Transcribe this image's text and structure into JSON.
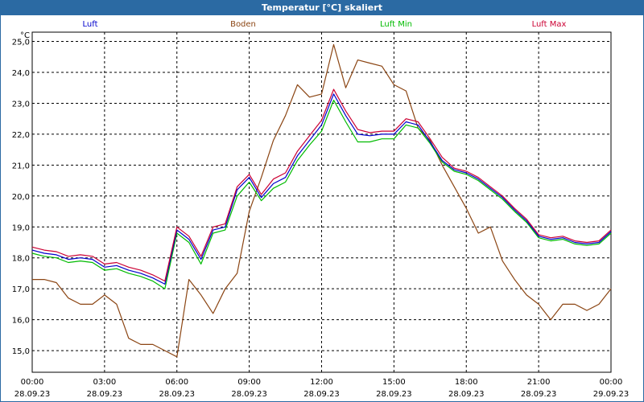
{
  "window": {
    "title": "Temperatur [°C] skaliert"
  },
  "chart_data": {
    "type": "line",
    "title": "Temperatur [°C] skaliert",
    "ylabel": "°C",
    "xlabel": "",
    "ylim": [
      14.3,
      25.3
    ],
    "xlim": [
      0,
      24
    ],
    "grid": true,
    "legend_position": "top",
    "y_ticks": [
      "15,0",
      "16,0",
      "17,0",
      "18,0",
      "19,0",
      "20,0",
      "21,0",
      "22,0",
      "23,0",
      "24,0",
      "25,0"
    ],
    "x_ticks": [
      {
        "time": "00:00",
        "date": "28.09.23"
      },
      {
        "time": "03:00",
        "date": "28.09.23"
      },
      {
        "time": "06:00",
        "date": "28.09.23"
      },
      {
        "time": "09:00",
        "date": "28.09.23"
      },
      {
        "time": "12:00",
        "date": "28.09.23"
      },
      {
        "time": "15:00",
        "date": "28.09.23"
      },
      {
        "time": "18:00",
        "date": "28.09.23"
      },
      {
        "time": "21:00",
        "date": "28.09.23"
      },
      {
        "time": "00:00",
        "date": "29.09.23"
      }
    ],
    "x": [
      0,
      0.5,
      1,
      1.5,
      2,
      2.5,
      3,
      3.5,
      4,
      4.5,
      5,
      5.5,
      6,
      6.5,
      7,
      7.5,
      8,
      8.5,
      9,
      9.5,
      10,
      10.5,
      11,
      11.5,
      12,
      12.5,
      13,
      13.5,
      14,
      14.5,
      15,
      15.5,
      16,
      16.5,
      17,
      17.5,
      18,
      18.5,
      19,
      19.5,
      20,
      20.5,
      21,
      21.5,
      22,
      22.5,
      23,
      23.5,
      24
    ],
    "series": [
      {
        "name": "Luft",
        "color": "#0000cc",
        "values": [
          18.25,
          18.15,
          18.1,
          17.95,
          18.0,
          17.95,
          17.7,
          17.75,
          17.6,
          17.5,
          17.35,
          17.15,
          18.9,
          18.6,
          17.95,
          18.9,
          19.0,
          20.2,
          20.6,
          19.95,
          20.4,
          20.6,
          21.3,
          21.8,
          22.3,
          23.3,
          22.6,
          22.0,
          21.95,
          22.0,
          22.0,
          22.4,
          22.3,
          21.75,
          21.15,
          20.85,
          20.75,
          20.55,
          20.25,
          19.95,
          19.55,
          19.2,
          18.7,
          18.6,
          18.65,
          18.5,
          18.45,
          18.5,
          18.85
        ]
      },
      {
        "name": "Boden",
        "color": "#8b4513",
        "values": [
          17.3,
          17.3,
          17.2,
          16.7,
          16.5,
          16.5,
          16.8,
          16.5,
          15.4,
          15.2,
          15.2,
          15.0,
          14.8,
          17.3,
          16.8,
          16.2,
          17.0,
          17.5,
          19.5,
          20.6,
          21.8,
          22.6,
          23.6,
          23.2,
          23.3,
          24.9,
          23.5,
          24.4,
          24.3,
          24.2,
          23.6,
          23.4,
          22.2,
          21.8,
          21.0,
          20.3,
          19.6,
          18.8,
          19.0,
          17.9,
          17.3,
          16.8,
          16.5,
          16.0,
          16.5,
          16.5,
          16.3,
          16.5,
          17.0
        ]
      },
      {
        "name": "Luft Min",
        "color": "#00bb00",
        "values": [
          18.15,
          18.05,
          18.0,
          17.85,
          17.9,
          17.85,
          17.6,
          17.65,
          17.5,
          17.4,
          17.25,
          17.0,
          18.8,
          18.5,
          17.8,
          18.8,
          18.9,
          20.0,
          20.45,
          19.85,
          20.25,
          20.45,
          21.15,
          21.65,
          22.1,
          23.1,
          22.4,
          21.75,
          21.75,
          21.85,
          21.85,
          22.3,
          22.2,
          21.7,
          21.1,
          20.8,
          20.7,
          20.5,
          20.2,
          19.9,
          19.5,
          19.15,
          18.65,
          18.55,
          18.6,
          18.45,
          18.4,
          18.45,
          18.8
        ]
      },
      {
        "name": "Luft Max",
        "color": "#cc0033",
        "values": [
          18.35,
          18.25,
          18.2,
          18.05,
          18.1,
          18.05,
          17.8,
          17.85,
          17.7,
          17.6,
          17.45,
          17.25,
          19.0,
          18.7,
          18.05,
          19.0,
          19.1,
          20.3,
          20.7,
          20.05,
          20.55,
          20.75,
          21.45,
          21.95,
          22.45,
          23.45,
          22.75,
          22.15,
          22.05,
          22.1,
          22.1,
          22.5,
          22.4,
          21.85,
          21.25,
          20.9,
          20.8,
          20.6,
          20.3,
          20.0,
          19.6,
          19.25,
          18.75,
          18.65,
          18.7,
          18.55,
          18.5,
          18.55,
          18.9
        ]
      }
    ]
  }
}
